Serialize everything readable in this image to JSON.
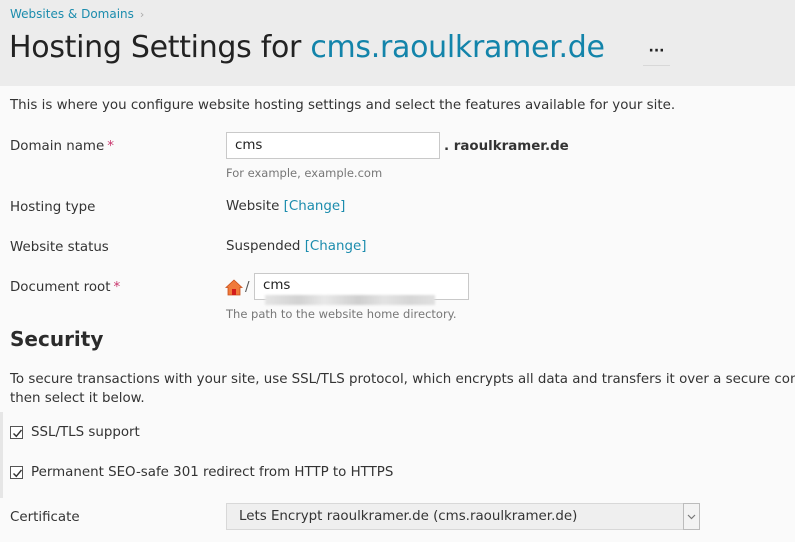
{
  "breadcrumb": {
    "items": [
      "Websites & Domains"
    ]
  },
  "header": {
    "title_prefix": "Hosting Settings for ",
    "title_domain": "cms.raoulkramer.de",
    "more_label": "···"
  },
  "intro": "This is where you configure website hosting settings and select the features available for your site.",
  "form": {
    "domain_name": {
      "label": "Domain name",
      "required_mark": "*",
      "value": "cms",
      "suffix": ". raoulkramer.de",
      "hint": "For example, example.com"
    },
    "hosting_type": {
      "label": "Hosting type",
      "value": "Website",
      "change_link": "[Change]"
    },
    "website_status": {
      "label": "Website status",
      "value": "Suspended",
      "change_link": "[Change]"
    },
    "document_root": {
      "label": "Document root",
      "required_mark": "*",
      "home_icon": "home-icon",
      "separator": "/",
      "value": "cms",
      "hint": "The path to the website home directory."
    }
  },
  "security": {
    "title": "Security",
    "description_line1": "To secure transactions with your site, use SSL/TLS protocol, which encrypts all data and transfers it over a secure connect",
    "description_line2": "then select it below.",
    "ssl_support": {
      "label": "SSL/TLS support",
      "checked": true
    },
    "redirect": {
      "label": "Permanent SEO-safe 301 redirect from HTTP to HTTPS",
      "checked": true
    },
    "certificate": {
      "label": "Certificate",
      "selected": "Lets Encrypt raoulkramer.de (cms.raoulkramer.de)"
    }
  },
  "colors": {
    "link": "#1b8cad",
    "title_domain": "#1384aa",
    "required": "#c8336a",
    "header_bg": "#ececec"
  }
}
